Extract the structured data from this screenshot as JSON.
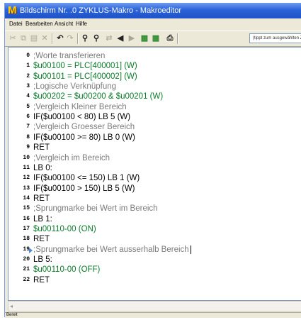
{
  "window": {
    "title": "Bildschirm Nr. .0 ZYKLUS-Makro - Makroeditor",
    "app_icon_letter": "M"
  },
  "menu": [
    "Datei",
    "Bearbeiten",
    "Ansicht",
    "Hilfe"
  ],
  "toolbar": {
    "search_value": "(tippt zum ausgewählten Ziel)",
    "icons": [
      "cut-icon",
      "copy-icon",
      "paste-icon",
      "delete-icon",
      "undo-icon",
      "redo-icon",
      "find-icon",
      "find-next-icon",
      "replace-icon",
      "prev-icon",
      "next-icon",
      "insert-icon",
      "insert-2-icon",
      "print-icon"
    ]
  },
  "editor": {
    "lines": [
      {
        "num": "0",
        "text": ";Worte transferieren",
        "style": "comment"
      },
      {
        "num": "1",
        "text": "$u00100 = PLC[400001] (W)",
        "style": "var"
      },
      {
        "num": "2",
        "text": "$u00101 = PLC[400002] (W)",
        "style": "var"
      },
      {
        "num": "3",
        "text": ";Logische Verknüpfung",
        "style": "comment"
      },
      {
        "num": "4",
        "text": "$u00202 = $u00200 & $u00201 (W)",
        "style": "var"
      },
      {
        "num": "5",
        "text": ";Vergleich Kleiner Bereich",
        "style": "comment"
      },
      {
        "num": "6",
        "text": "IF($u00100 < 80) LB 5 (W)",
        "style": "ctl"
      },
      {
        "num": "7",
        "text": ";Vergleich Groesser Bereich",
        "style": "comment"
      },
      {
        "num": "8",
        "text": "IF($u00100 >= 80) LB 0 (W)",
        "style": "ctl"
      },
      {
        "num": "9",
        "text": "RET",
        "style": "plain"
      },
      {
        "num": "10",
        "text": ";Vergleich im Bereich",
        "style": "comment"
      },
      {
        "num": "11",
        "text": "LB 0:",
        "style": "plain"
      },
      {
        "num": "12",
        "text": "IF($u00100 <= 150) LB 1 (W)",
        "style": "ctl"
      },
      {
        "num": "13",
        "text": "IF($u00100 > 150) LB 5 (W)",
        "style": "ctl"
      },
      {
        "num": "14",
        "text": "RET",
        "style": "plain"
      },
      {
        "num": "15",
        "text": ";Sprungmarke bei Wert im Bereich",
        "style": "comment"
      },
      {
        "num": "16",
        "text": "LB 1:",
        "style": "plain"
      },
      {
        "num": "17",
        "text": "$u00110-00 (ON)",
        "style": "var"
      },
      {
        "num": "18",
        "text": "RET",
        "style": "plain"
      },
      {
        "num": "19",
        "text": ";Sprungmarke bei Wert ausserhalb Bereich",
        "style": "comment"
      },
      {
        "num": "20",
        "text": "LB 5:",
        "style": "plain"
      },
      {
        "num": "21",
        "text": "$u00110-00 (OFF)",
        "style": "var"
      },
      {
        "num": "22",
        "text": "RET",
        "style": "plain"
      }
    ],
    "current_line": "19"
  },
  "status": {
    "text": "Bereit"
  },
  "colors": {
    "titlebar": "#2a63d8",
    "chrome": "#ece9d8",
    "comment": "#7b7b7b",
    "variable": "#0a7a2a"
  }
}
